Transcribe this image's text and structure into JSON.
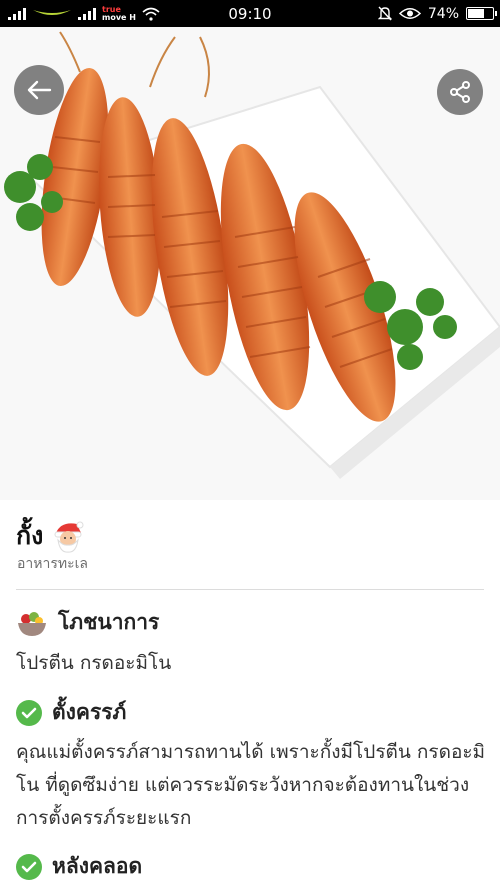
{
  "status_bar": {
    "time": "09:10",
    "carrier_line1": "true",
    "carrier_line2": "move H",
    "battery": "74%",
    "battery_level": 0.74
  },
  "hero": {
    "back_icon": "arrow-left-icon",
    "share_icon": "share-icon"
  },
  "food": {
    "name": "กั้ง",
    "badge_icon": "santa-emoji-icon",
    "category": "อาหารทะเล"
  },
  "nutrition": {
    "title": "โภชนาการ",
    "icon": "salad-bowl-icon",
    "text": "โปรตีน กรดอะมิโน"
  },
  "pregnant": {
    "title": "ตั้งครรภ์",
    "icon": "check-circle-icon",
    "text": "คุณแม่ตั้งครรภ์สามารถทานได้ เพราะกั้งมีโปรตีน กรดอะมิโน ที่ดูดซึมง่าย แต่ควรระมัดระวังหากจะต้องทานในช่วงการตั้งครรภ์ระยะแรก"
  },
  "postpartum": {
    "title": "หลังคลอด",
    "icon": "check-circle-icon"
  },
  "colors": {
    "accent_green": "#55b94b",
    "status_bar": "#000000"
  }
}
